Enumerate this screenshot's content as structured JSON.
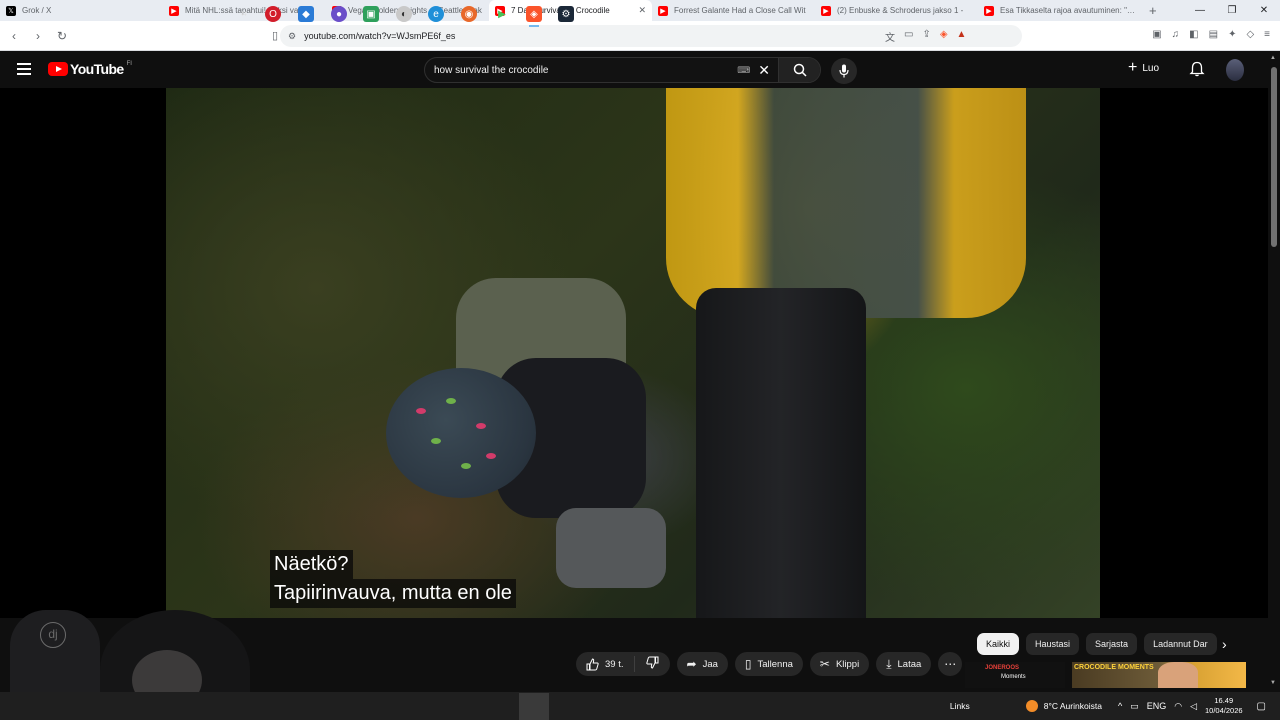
{
  "browser": {
    "tabs": [
      {
        "icon": "x-logo-icon",
        "title": "Grok / X",
        "active": false
      },
      {
        "icon": "youtube-icon",
        "title": "Mitä NHL:ssä tapahtui! Kaksi valme",
        "active": false
      },
      {
        "icon": "youtube-icon",
        "title": "Vegas Golden Knights at Seattle Krak",
        "active": false
      },
      {
        "icon": "youtube-icon",
        "title": "7 Day Survival on Crocodile",
        "active": true
      },
      {
        "icon": "youtube-icon",
        "title": "Forrest Galante Had a Close Call Wit",
        "active": false
      },
      {
        "icon": "youtube-icon",
        "title": "(2) Enbuske & Schroderus jakso 1 -",
        "active": false
      },
      {
        "icon": "youtube-icon",
        "title": "Esa Tikkaselta rajoa avautuminen: \"Ku",
        "active": false
      }
    ],
    "url": "youtube.com/watch?v=WJsmPE6f_es"
  },
  "youtube": {
    "logo_text": "YouTube",
    "region": "FI",
    "search_query": "how survival the crocodile",
    "create_label": "Luo"
  },
  "video": {
    "subtitle_line1": "Näetkö?",
    "subtitle_line2": "Tapiirinvauva, mutta en ole"
  },
  "actions": {
    "likes": "39 t.",
    "share": "Jaa",
    "save": "Tallenna",
    "clip": "Klippi",
    "download": "Lataa"
  },
  "chips": [
    "Kaikki",
    "Haustasi",
    "Sarjasta",
    "Ladannut Dar"
  ],
  "suggested": {
    "thumb1_line1": "JONEROOS",
    "thumb1_line2": "Moments",
    "thumb2_text": "CROCODILE MOMENTS"
  },
  "webcam": {
    "logo_text": "dj"
  },
  "taskbar": {
    "links": "Links",
    "weather": "8°C  Aurinkoista",
    "lang": "ENG",
    "time": "16.49",
    "date": "10/04/2026"
  },
  "colors": {
    "yt_red": "#ff0000",
    "yt_bg": "#0f0f0f",
    "chip_selected": "#f1f1f1"
  }
}
